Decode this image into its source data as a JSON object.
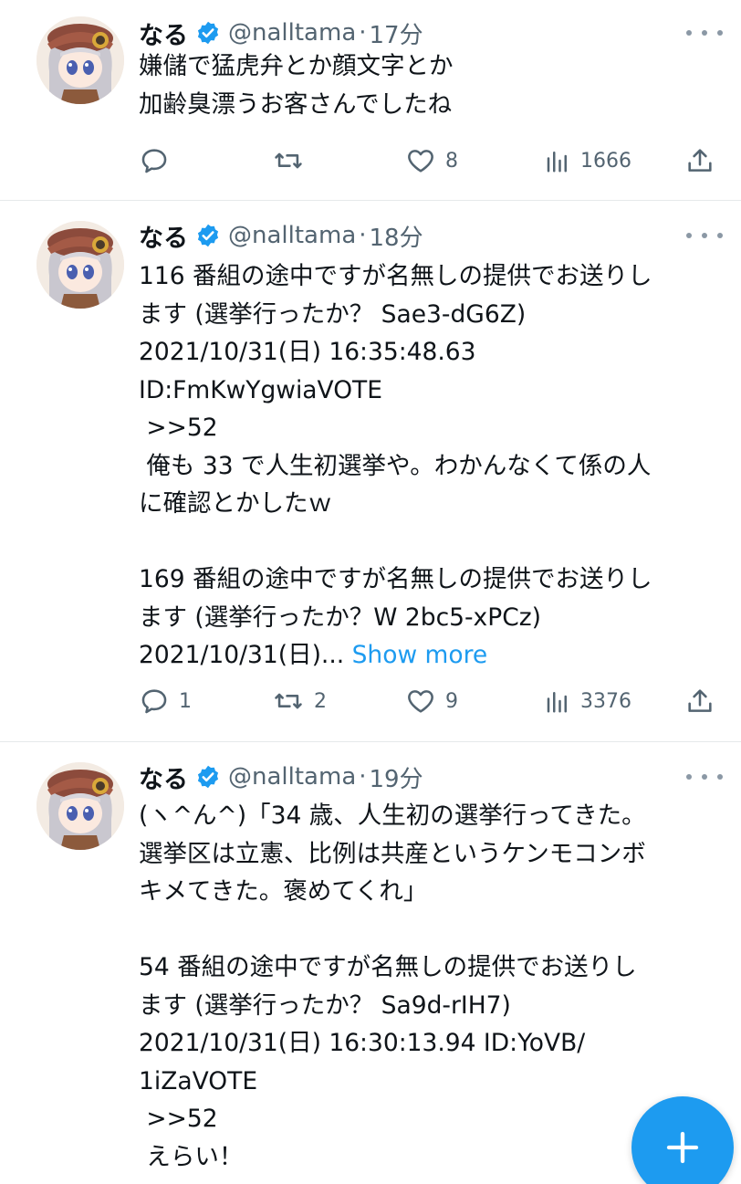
{
  "tweets": [
    {
      "name": "なる",
      "handle": "@nalltama",
      "dot": "·",
      "time": "17分",
      "lines": [
        "嫌儲で猛虎弁とか顔文字とか",
        "加齢臭漂うお客さんでしたね"
      ],
      "show_more": "",
      "reply_count": "",
      "retweet_count": "",
      "like_count": "8",
      "view_count": "1666"
    },
    {
      "name": "なる",
      "handle": "@nalltama",
      "dot": "·",
      "time": "18分",
      "lines": [
        "116 番組の途中ですが名無しの提供でお送りし",
        "ます (選挙行ったか？ Sae3-dG6Z)",
        "2021/10/31(日) 16:35:48.63",
        "ID:FmKwYgwiaVOTE",
        " >>52",
        " 俺も 33 で人生初選挙や。わかんなくて係の人",
        "に確認とかしたｗ",
        "",
        "169 番組の途中ですが名無しの提供でお送りし",
        "ます (選挙行ったか？W 2bc5-xPCz)",
        "2021/10/31(日)... "
      ],
      "show_more": "Show more",
      "reply_count": "1",
      "retweet_count": "2",
      "like_count": "9",
      "view_count": "3376"
    },
    {
      "name": "なる",
      "handle": "@nalltama",
      "dot": "·",
      "time": "19分",
      "lines": [
        "(ヽ^ん^)「34 歳、人生初の選挙行ってきた。",
        "選挙区は立憲、比例は共産というケンモコンボ",
        "キメてきた。褒めてくれ」",
        "",
        "54 番組の途中ですが名無しの提供でお送りし",
        "ます (選挙行ったか？ Sa9d-rIH7)",
        "2021/10/31(日) 16:30:13.94 ID:YoVB/",
        "1iZaVOTE",
        " >>52",
        " えらい！"
      ]
    }
  ],
  "icons": {
    "verified": "verified-badge-icon",
    "reply": "reply-icon",
    "retweet": "retweet-icon",
    "like": "heart-icon",
    "views": "views-bar-chart-icon",
    "share": "share-upload-icon",
    "more": "more-dots-icon",
    "compose": "plus-icon"
  },
  "colors": {
    "accent": "#1d9bf0",
    "text": "#0f1419",
    "secondary": "#536471",
    "divider": "#e6e9ea"
  }
}
